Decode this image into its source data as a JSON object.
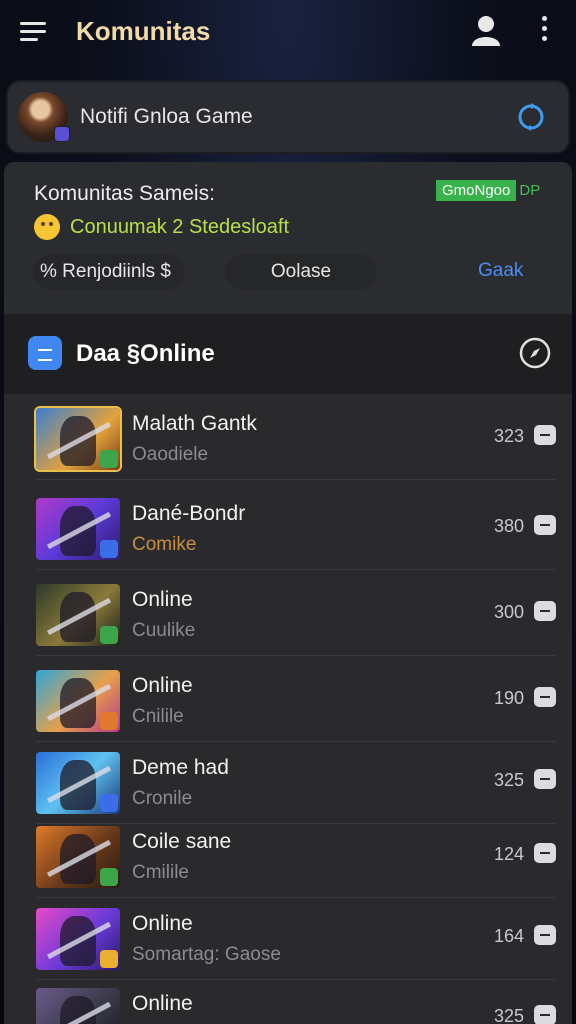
{
  "header": {
    "title": "Komunitas",
    "menu_icon": "hamburger-menu-icon",
    "profile_icon": "user-icon",
    "more_icon": "kebab-menu-icon"
  },
  "notification": {
    "text": "Notifi Gnloa Game",
    "action_icon": "sync-icon"
  },
  "community": {
    "title": "Komunitas Sameis:",
    "status_badge": "GmoNgoo",
    "status_extra": "DP",
    "subtitle": "Conuumak 2 Stedesloaft",
    "buttons": {
      "left": "% Renjodiinls $",
      "middle": "Oolase",
      "right": "Gaak"
    }
  },
  "online_panel": {
    "title": "Daa §Online",
    "rows": [
      {
        "name": "Malath Gantk",
        "status": "Oaodiele",
        "count": "323"
      },
      {
        "name": "Dané-Bondr",
        "status": "Comike",
        "count": "380"
      },
      {
        "name": "Online",
        "status": "Cuulike",
        "count": "300"
      },
      {
        "name": "Online",
        "status": "Cnilile",
        "count": "190"
      },
      {
        "name": "Deme had",
        "status": "Cronile",
        "count": "325"
      },
      {
        "name": "Coile sane",
        "status": "Cmilile",
        "count": "124"
      },
      {
        "name": "Online",
        "status": "Somartag: Gaose",
        "count": "164"
      },
      {
        "name": "Online",
        "status": "",
        "count": "325"
      }
    ]
  },
  "colors": {
    "title_accent": "#f3dba6",
    "status_green": "#38b24a",
    "subtitle_lime": "#b7e048",
    "link_blue": "#4a8df5",
    "panel_icon_blue": "#3f88f2",
    "row_2_status": "#c88e3e"
  }
}
